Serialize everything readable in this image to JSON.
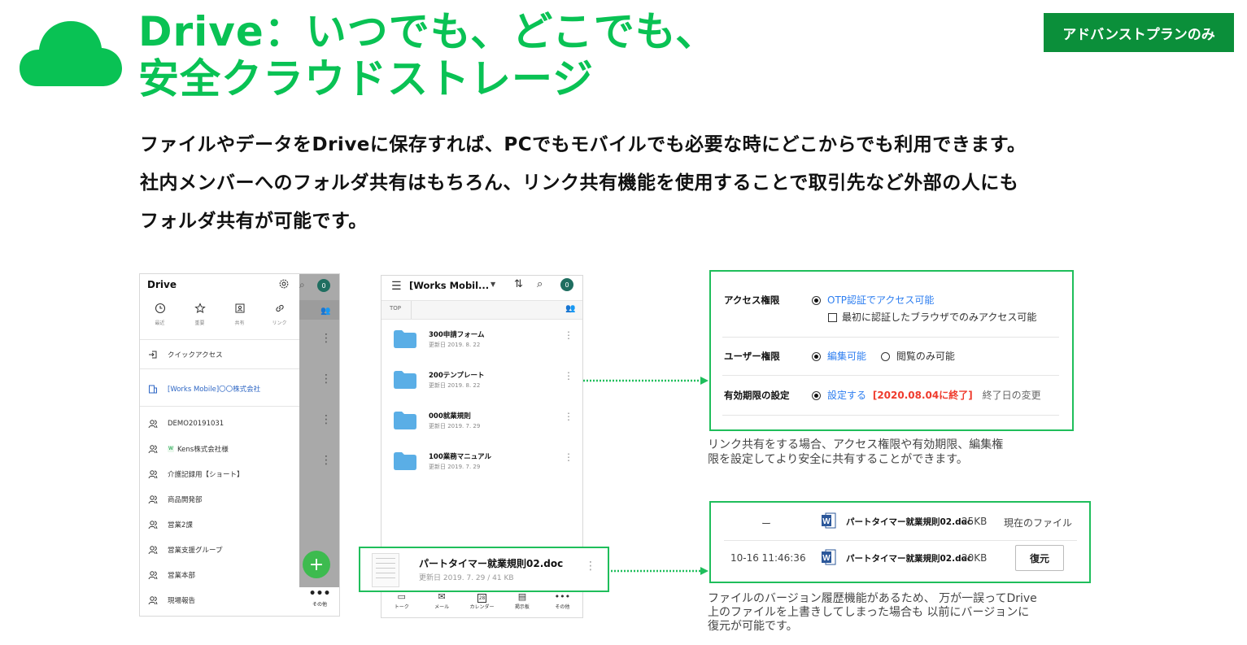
{
  "header": {
    "title_line1": "Drive：いつでも、どこでも、",
    "title_line2": "安全クラウドストレージ",
    "badge": "アドバンストプランのみ",
    "desc_lines": [
      "ファイルやデータをDriveに保存すれば、PCでもモバイルでも必要な時にどこからでも利用できます。",
      "社内メンバーへのフォルダ共有はもちろん、リンク共有機能を使用することで取引先など外部の人にも",
      "フォルダ共有が可能です。"
    ]
  },
  "colors": {
    "brand_green": "#09c254",
    "badge_green": "#0b8f3a",
    "link_blue": "#2d7ef0",
    "alert_red": "#ef3b2d"
  },
  "phone1": {
    "title": "Drive",
    "avatar": "0",
    "quick_icons": [
      {
        "icon": "clock-icon",
        "label": "最近"
      },
      {
        "icon": "star-icon",
        "label": "重要"
      },
      {
        "icon": "shared-icon",
        "label": "共有"
      },
      {
        "icon": "link-icon",
        "label": "リンク"
      }
    ],
    "quick_access": "クイックアクセス",
    "company": "[Works Mobile]〇〇株式会社",
    "groups": [
      "DEMO20191031",
      "Kens株式会社様",
      "介護記録用【ショート】",
      "商品開発部",
      "営業2課",
      "営業支援グループ",
      "営業本部",
      "現場報告"
    ],
    "fab": "+",
    "other_label": "その他"
  },
  "phone2": {
    "title": "[Works Mobil...",
    "avatar": "0",
    "crumb": "TOP",
    "folders": [
      {
        "name": "300申請フォーム",
        "date": "更新日 2019. 8. 22"
      },
      {
        "name": "200テンプレート",
        "date": "更新日 2019. 8. 22"
      },
      {
        "name": "000就業規則",
        "date": "更新日 2019. 7. 29"
      },
      {
        "name": "100業務マニュアル",
        "date": "更新日 2019. 7. 29"
      }
    ],
    "tabs": [
      {
        "icon": "chat-icon",
        "label": "トーク"
      },
      {
        "icon": "mail-icon",
        "label": "メール"
      },
      {
        "icon": "calendar-icon",
        "label": "カレンダー",
        "day": "28"
      },
      {
        "icon": "board-icon",
        "label": "掲示板"
      },
      {
        "icon": "more-icon",
        "label": "その他"
      }
    ]
  },
  "file_card": {
    "name": "パートタイマー就業規則02.doc",
    "meta": "更新日 2019. 7. 29 / 41 KB"
  },
  "permissions": {
    "access": {
      "label": "アクセス権限",
      "option": "OTP認証でアクセス可能",
      "checkbox": "最初に認証したブラウザでのみアクセス可能"
    },
    "user": {
      "label": "ユーザー権限",
      "opt1": "編集可能",
      "opt2": "閲覧のみ可能"
    },
    "expiry": {
      "label": "有効期限の設定",
      "opt": "設定する",
      "date": "[2020.08.04に終了]",
      "change": "終了日の変更"
    }
  },
  "note1_lines": [
    "リンク共有をする場合、アクセス権限や有効期限、編集権",
    "限を設定してより安全に共有することができます。"
  ],
  "versions": [
    {
      "time": "ー",
      "name": "パートタイマー就業規則02.doc",
      "size": "25KB",
      "status": "現在のファイル"
    },
    {
      "time": "10-16 11:46:36",
      "name": "パートタイマー就業規則02.doc",
      "size": "20KB",
      "action": "復元"
    }
  ],
  "note2_lines": [
    "ファイルのバージョン履歴機能があるため、 万が一誤ってDrive",
    "上のファイルを上書きしてしまった場合も 以前にバージョンに",
    "復元が可能です。"
  ]
}
